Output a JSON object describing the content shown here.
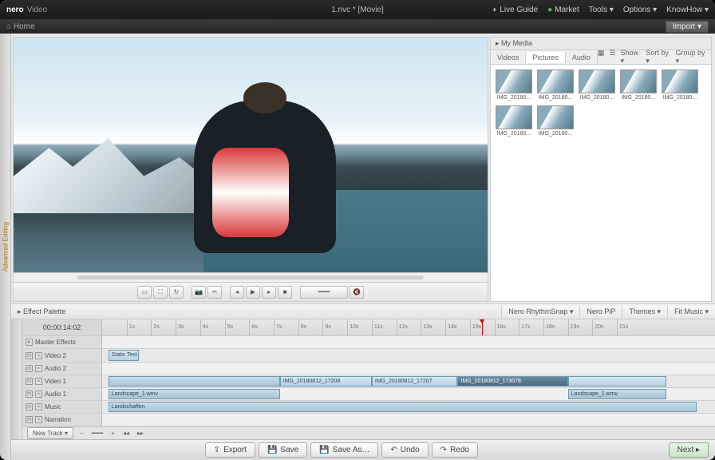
{
  "titlebar": {
    "brand": "nero",
    "product": "Video",
    "project": "1.nvc * [Movie]",
    "live_guide": "Live Guide",
    "market": "Market",
    "tools": "Tools ▾",
    "options": "Options ▾",
    "knowhow": "KnowHow ▾"
  },
  "homebar": {
    "home": "Home",
    "import": "Import ▾"
  },
  "left_tab": "Advanced Editing",
  "media": {
    "header": "▸ My Media",
    "tabs": {
      "videos": "Videos",
      "pictures": "Pictures",
      "audio": "Audio"
    },
    "tools": {
      "show": "Show ▾",
      "sort": "Sort by ▾",
      "group": "Group by ▾"
    },
    "items": [
      {
        "label": "IMG_20180..."
      },
      {
        "label": "IMG_20180..."
      },
      {
        "label": "IMG_20180..."
      },
      {
        "label": "IMG_20180..."
      },
      {
        "label": "IMG_20180..."
      },
      {
        "label": "IMG_20180..."
      },
      {
        "label": "IMG_20180..."
      }
    ]
  },
  "palette": {
    "label": "▸ Effect Palette",
    "tabs": {
      "rhythm": "Nero RhythmSnap ▾",
      "pip": "Nero PiP",
      "themes": "Themes ▾",
      "music": "Fit Music ▾"
    }
  },
  "timeline": {
    "timecode": "00:00:14:02",
    "ticks": [
      "1s",
      "2s",
      "3s",
      "4s",
      "5s",
      "6s",
      "7s",
      "8s",
      "9s",
      "10s",
      "11s",
      "12s",
      "13s",
      "14s",
      "15s",
      "16s",
      "17s",
      "18s",
      "19s",
      "20s",
      "21s"
    ],
    "tracks": {
      "master": "Master Effects",
      "video2": "Video 2",
      "audio2": "Audio 2",
      "video1": "Video 1",
      "audio1": "Audio 1",
      "music": "Music",
      "narration": "Narration"
    },
    "static_text": "Static Text",
    "clips": {
      "a1_left": "Landscape_1.wmv",
      "v1_c1": "IMG_20180812_17208",
      "v1_c2": "IMG_20180812_17207",
      "v1_c3": "IMG_20180812_173078",
      "a1_right": "Landscape_1.wmv",
      "music": "Landschaften"
    },
    "new_track": "New Track ▾"
  },
  "bottom": {
    "export": "Export",
    "save": "Save",
    "save_as": "Save As…",
    "undo": "Undo",
    "redo": "Redo",
    "next": "Next ▸"
  }
}
